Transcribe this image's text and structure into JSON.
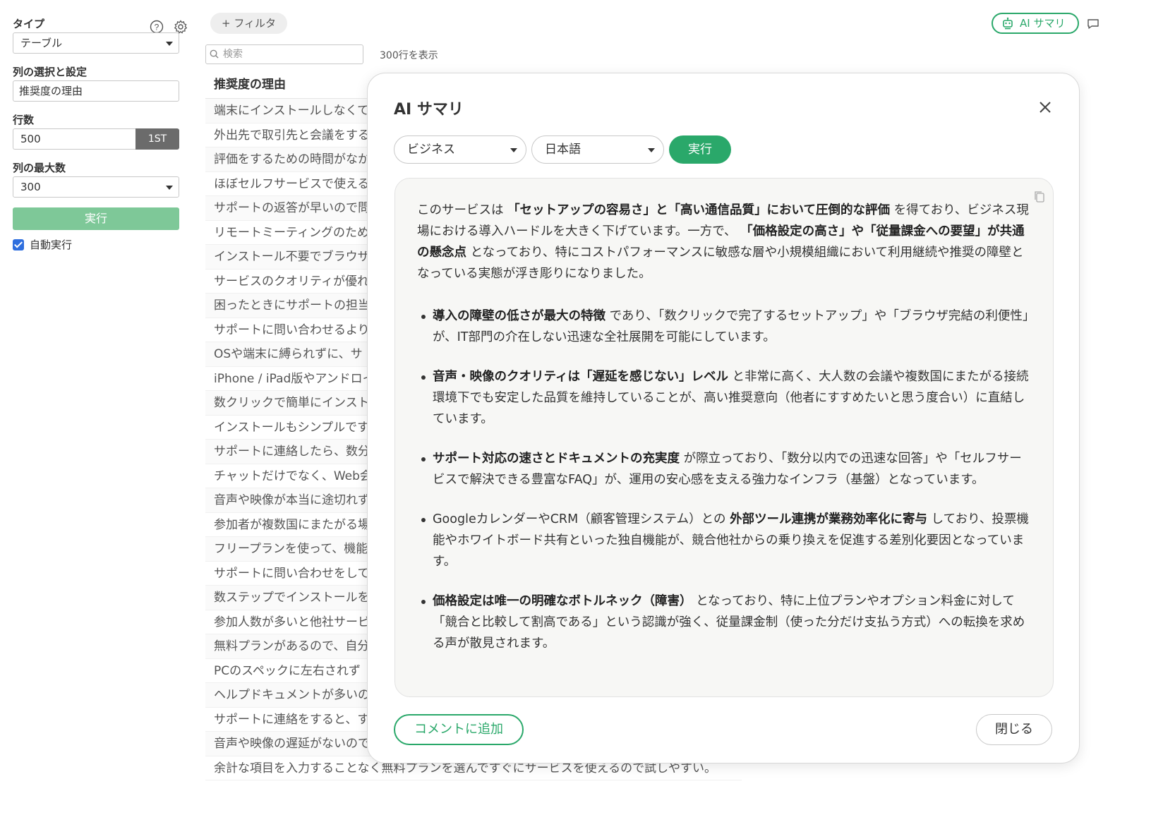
{
  "sidebar": {
    "type_label": "タイプ",
    "type_value": "テーブル",
    "columns_label": "列の選択と設定",
    "columns_value": "推奨度の理由",
    "rows_label": "行数",
    "rows_value": "500",
    "rows_unit": "1ST",
    "maxcols_label": "列の最大数",
    "maxcols_value": "300",
    "run_label": "実行",
    "auto_run_label": "自動実行"
  },
  "toolbar": {
    "filter_label": "+ フィルタ",
    "search_placeholder": "検索",
    "row_count": "300行を表示",
    "ai_summary_label": "AI サマリ"
  },
  "table": {
    "header": "推奨度の理由",
    "rows": [
      "端末にインストールしなくて",
      "外出先で取引先と会議をする",
      "評価をするための時間がなか",
      "ほぼセルフサービスで使える",
      "サポートの返答が早いので問",
      "リモートミーティングのため",
      "インストール不要でブラウザ",
      "サービスのクオリティが優れ",
      "困ったときにサポートの担当",
      "サポートに問い合わせるより",
      "OSや端末に縛られずに、サ",
      "iPhone / iPad版やアンドロイ",
      "数クリックで簡単にインスト",
      "インストールもシンプルです",
      "サポートに連絡したら、数分",
      "チャットだけでなく、Web会",
      "音声や映像が本当に途切れず",
      "参加者が複数国にまたがる場",
      "フリープランを使って、機能",
      "サポートに問い合わせをして",
      "数ステップでインストールを",
      "参加人数が多いと他社サービ",
      "無料プランがあるので、自分",
      "PCのスペックに左右されず",
      "ヘルプドキュメントが多いの",
      "サポートに連絡をすると、す",
      "音声や映像の遅延がないので",
      "余計な項目を入力することなく無料プランを選んですぐにサービスを使えるので試しやすい。"
    ]
  },
  "modal": {
    "title": "AI サマリ",
    "tone_value": "ビジネス",
    "language_value": "日本語",
    "run_label": "実行",
    "intro": {
      "t1": "このサービスは ",
      "b1": "「セットアップの容易さ」と「高い通信品質」において圧倒的な評価",
      "t2": " を得ており、ビジネス現場における導入ハードルを大きく下げています。一方で、 ",
      "b2": "「価格設定の高さ」や「従量課金への要望」が共通の懸念点",
      "t3": " となっており、特にコストパフォーマンスに敏感な層や小規模組織において利用継続や推奨の障壁となっている実態が浮き彫りになりました。"
    },
    "bullets": [
      {
        "pre": "",
        "bold": "導入の障壁の低さが最大の特徴",
        "post": " であり、「数クリックで完了するセットアップ」や「ブラウザ完結の利便性」が、IT部門の介在しない迅速な全社展開を可能にしています。"
      },
      {
        "pre": "",
        "bold": "音声・映像のクオリティは「遅延を感じない」レベル",
        "post": " と非常に高く、大人数の会議や複数国にまたがる接続環境下でも安定した品質を維持していることが、高い推奨意向（他者にすすめたいと思う度合い）に直結しています。"
      },
      {
        "pre": "",
        "bold": "サポート対応の速さとドキュメントの充実度",
        "post": " が際立っており、「数分以内での迅速な回答」や「セルフサービスで解決できる豊富なFAQ」が、運用の安心感を支える強力なインフラ（基盤）となっています。"
      },
      {
        "pre": "GoogleカレンダーやCRM（顧客管理システム）との ",
        "bold": "外部ツール連携が業務効率化に寄与",
        "post": " しており、投票機能やホワイトボード共有といった独自機能が、競合他社からの乗り換えを促進する差別化要因となっています。"
      },
      {
        "pre": "",
        "bold": "価格設定は唯一の明確なボトルネック（障害）",
        "post": " となっており、特に上位プランやオプション料金に対して「競合と比較して割高である」という認識が強く、従量課金制（使った分だけ支払う方式）への転換を求める声が散見されます。"
      }
    ],
    "add_comment_label": "コメントに追加",
    "close_label": "閉じる"
  },
  "colors": {
    "accent": "#2aa86a",
    "run_disabled": "#7ec898",
    "checkbox": "#2f6fde"
  },
  "icons": [
    "help-icon",
    "gear-icon",
    "search-icon",
    "robot-icon",
    "comment-icon",
    "close-icon",
    "copy-icon"
  ]
}
